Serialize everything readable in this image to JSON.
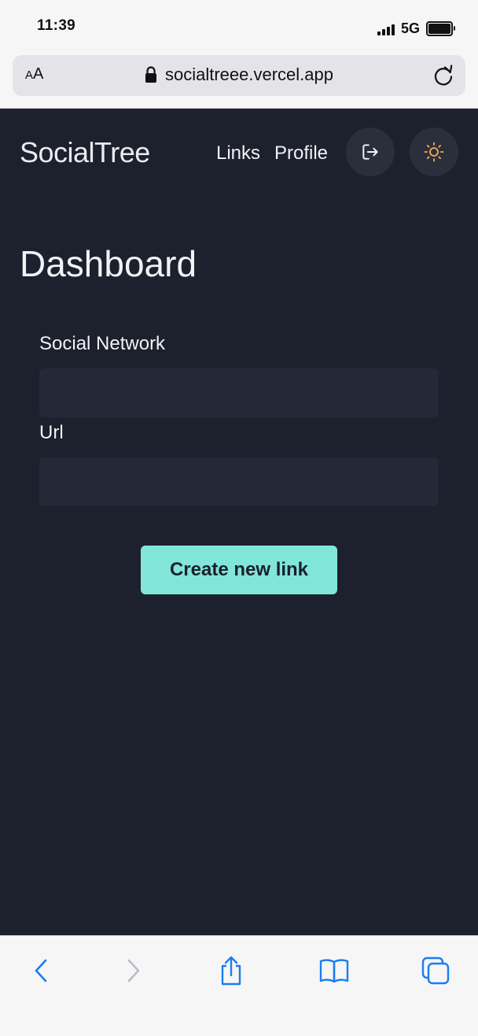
{
  "status_bar": {
    "time": "11:39",
    "network": "5G"
  },
  "browser": {
    "aa_label_small": "A",
    "aa_label_large": "A",
    "url": "socialtreee.vercel.app"
  },
  "header": {
    "brand": "SocialTree",
    "nav": {
      "links_label": "Links",
      "profile_label": "Profile"
    }
  },
  "main": {
    "title": "Dashboard",
    "form": {
      "network_label": "Social Network",
      "network_value": "",
      "url_label": "Url",
      "url_value": "",
      "submit_label": "Create new link"
    }
  },
  "colors": {
    "page_background": "#1d202d",
    "input_background": "#252937",
    "accent_button": "#81e6d9",
    "theme_icon": "#f6ad55",
    "ios_blue": "#1a7df0"
  },
  "icons": {
    "logout": "logout-icon",
    "theme": "sun-icon",
    "back": "chevron-left-icon",
    "forward": "chevron-right-icon",
    "share": "share-icon",
    "bookmarks": "book-icon",
    "tabs": "tabs-icon"
  }
}
